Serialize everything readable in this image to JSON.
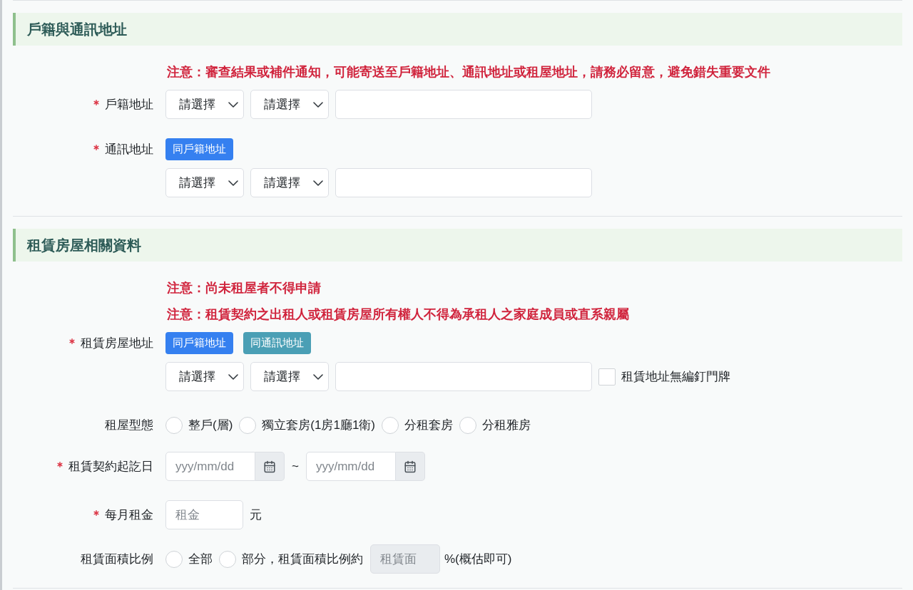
{
  "sections": [
    {
      "title": "戶籍與通訊地址",
      "notices": [
        "注意：審查結果或補件通知，可能寄送至戶籍地址、通訊地址或租屋地址，請務必留意，避免錯失重要文件"
      ],
      "fields": [
        {
          "kind": "address",
          "label": "戶籍地址",
          "required": true,
          "selects": [
            {
              "value": "請選擇"
            },
            {
              "value": "請選擇"
            }
          ]
        },
        {
          "kind": "address",
          "label": "通訊地址",
          "required": true,
          "copy_buttons": [
            {
              "label": "同戶籍地址",
              "color": "#3580f0"
            }
          ],
          "selects": [
            {
              "value": "請選擇"
            },
            {
              "value": "請選擇"
            }
          ]
        }
      ]
    },
    {
      "title": "租賃房屋相關資料",
      "notices": [
        "注意：尚未租屋者不得申請",
        "注意：租賃契約之出租人或租賃房屋所有權人不得為承租人之家庭成員或直系親屬"
      ],
      "fields": [
        {
          "kind": "address",
          "label": "租賃房屋地址",
          "required": true,
          "copy_buttons": [
            {
              "label": "同戶籍地址",
              "color": "#3580f0"
            },
            {
              "label": "同通訊地址",
              "color": "#4a9fb5"
            }
          ],
          "selects": [
            {
              "value": "請選擇"
            },
            {
              "value": "請選擇"
            }
          ],
          "checkbox": {
            "label": "租賃地址無編釘門牌",
            "checked": false
          }
        },
        {
          "kind": "radio_group",
          "label": "租屋型態",
          "required": false,
          "options": [
            {
              "label": "整戶(層)",
              "selected": false
            },
            {
              "label": "獨立套房(1房1廳1衛)",
              "selected": false
            },
            {
              "label": "分租套房",
              "selected": false
            },
            {
              "label": "分租雅房",
              "selected": false
            }
          ]
        },
        {
          "kind": "date_range",
          "label": "租賃契約起訖日",
          "required": true,
          "from": {
            "placeholder": "yyy/mm/dd"
          },
          "separator": "~",
          "to": {
            "placeholder": "yyy/mm/dd"
          }
        },
        {
          "kind": "amount",
          "label": "每月租金",
          "required": true,
          "placeholder": "租金",
          "unit": "元"
        },
        {
          "kind": "area_ratio",
          "label": "租賃面積比例",
          "required": false,
          "options": [
            {
              "label": "全部",
              "selected": false
            },
            {
              "label": "部分，租賃面積比例約",
              "selected": false
            }
          ],
          "ratio_input": {
            "placeholder": "租賃面",
            "disabled": true
          },
          "suffix": "%(概估即可)"
        }
      ]
    }
  ]
}
